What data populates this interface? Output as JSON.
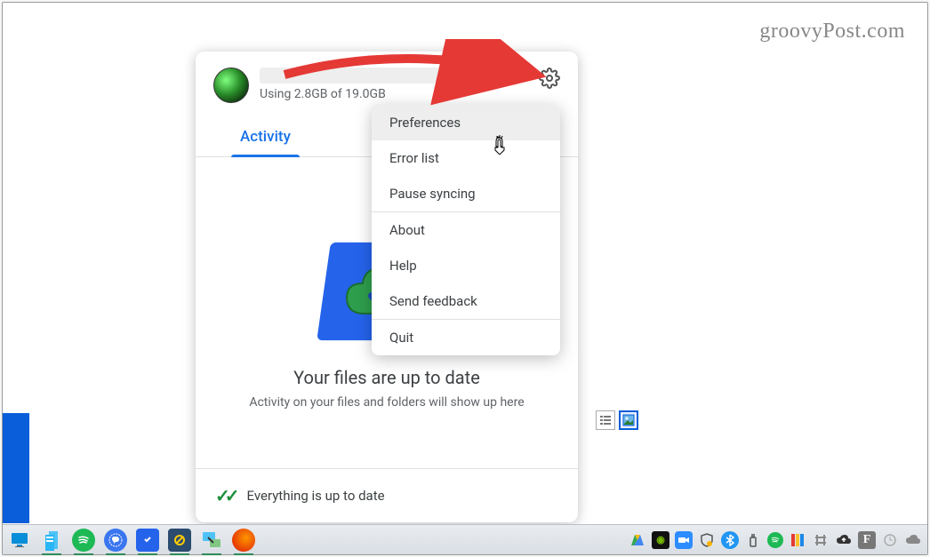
{
  "watermark": "groovyPost.com",
  "header": {
    "storage": "Using 2.8GB of 19.0GB"
  },
  "tabs": {
    "activity": "Activity"
  },
  "body": {
    "title": "Your files are up to date",
    "subtitle": "Activity on your files and folders will show up here"
  },
  "status": {
    "text": "Everything is up to date"
  },
  "menu": {
    "preferences": "Preferences",
    "error_list": "Error list",
    "pause_syncing": "Pause syncing",
    "about": "About",
    "help": "Help",
    "send_feedback": "Send feedback",
    "quit": "Quit"
  }
}
